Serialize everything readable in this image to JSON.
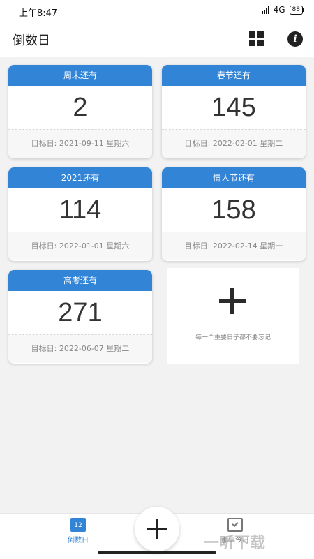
{
  "status_bar": {
    "time": "上午8:47",
    "network": "4G",
    "battery": "88"
  },
  "header": {
    "title": "倒数日"
  },
  "cards": [
    {
      "title": "周末还有",
      "days": "2",
      "target": "目标日: 2021-09-11 星期六"
    },
    {
      "title": "春节还有",
      "days": "145",
      "target": "目标日: 2022-02-01 星期二"
    },
    {
      "title": "2021还有",
      "days": "114",
      "target": "目标日: 2022-01-01 星期六"
    },
    {
      "title": "情人节还有",
      "days": "158",
      "target": "目标日: 2022-02-14 星期一"
    },
    {
      "title": "高考还有",
      "days": "271",
      "target": "目标日: 2022-06-07 星期二"
    }
  ],
  "add_card": {
    "hint": "每一个重要日子都不要忘记"
  },
  "bottom_nav": {
    "countdown_label": "倒数日",
    "countdown_icon_number": "12",
    "history_label": "那年今日"
  },
  "watermark": "一听下载",
  "colors": {
    "accent": "#3284d6",
    "background": "#f2f2f2"
  }
}
